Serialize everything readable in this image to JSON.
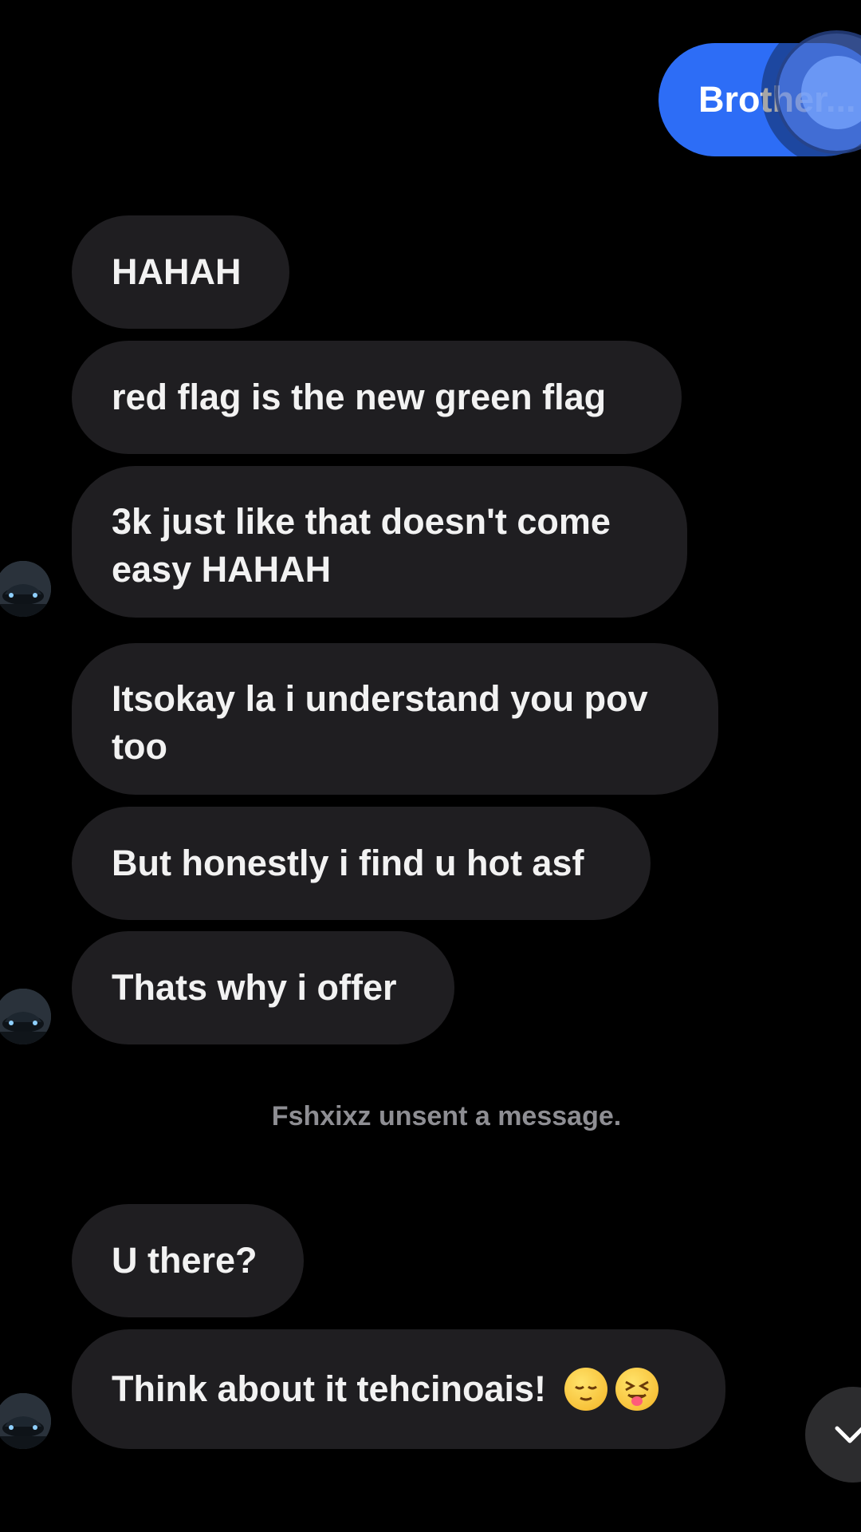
{
  "sent_messages": [
    {
      "text": "Brother..."
    }
  ],
  "received_messages": [
    {
      "text": "HAHAH"
    },
    {
      "text": "red flag is the new green flag"
    },
    {
      "text": "3k just like that doesn't come\neasy HAHAH"
    },
    {
      "text": "Itsokay la i understand you pov\ntoo"
    },
    {
      "text": "But honestly i find u hot asf"
    },
    {
      "text": "Thats why i offer"
    },
    {
      "text": "U there?"
    },
    {
      "text": "Think about it tehcinoais! ",
      "emojis": [
        "relieved-face-emoji",
        "squinting-tongue-emoji"
      ]
    }
  ],
  "system_note": "Fshxixz unsent a message.",
  "colors": {
    "background": "#000000",
    "received_bubble": "#1f1e21",
    "sent_bubble": "#2d6df6",
    "system_text": "#8e8e93"
  },
  "icons": {
    "scroll_down": "chevron-down-icon",
    "avatar": "contact-avatar-car"
  }
}
